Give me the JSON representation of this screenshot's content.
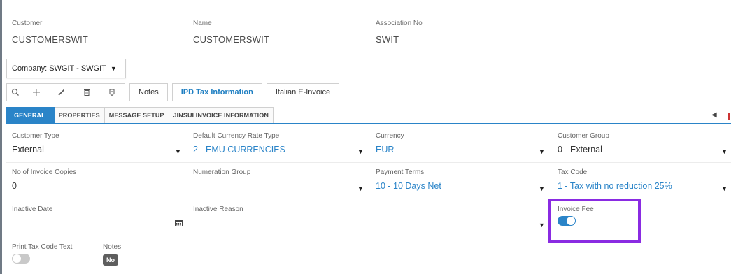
{
  "header": {
    "customer": {
      "label": "Customer",
      "value": "CUSTOMERSWIT"
    },
    "name": {
      "label": "Name",
      "value": "CUSTOMERSWIT"
    },
    "association": {
      "label": "Association No",
      "value": "SWIT"
    }
  },
  "company": {
    "label": "Company: SWGIT - SWGIT"
  },
  "toolbar": {
    "icons": [
      "search-icon",
      "add-icon",
      "edit-icon",
      "delete-icon",
      "duplicate-icon"
    ],
    "notes_label": "Notes",
    "ipd_label": "IPD Tax Information",
    "italian_label": "Italian E-Invoice"
  },
  "tabs": [
    {
      "label": "GENERAL",
      "active": true
    },
    {
      "label": "PROPERTIES",
      "active": false
    },
    {
      "label": "MESSAGE SETUP",
      "active": false
    },
    {
      "label": "JINSUI INVOICE INFORMATION",
      "active": false
    }
  ],
  "form": {
    "customer_type": {
      "label": "Customer Type",
      "value": "External"
    },
    "currency_rate_type": {
      "label": "Default Currency Rate Type",
      "value": "2 - EMU CURRENCIES"
    },
    "currency": {
      "label": "Currency",
      "value": "EUR"
    },
    "customer_group": {
      "label": "Customer Group",
      "value": "0 - External"
    },
    "invoice_copies": {
      "label": "No of Invoice Copies",
      "value": "0"
    },
    "numeration_group": {
      "label": "Numeration Group",
      "value": ""
    },
    "payment_terms": {
      "label": "Payment Terms",
      "value": "10 - 10 Days Net"
    },
    "tax_code": {
      "label": "Tax Code",
      "value": "1 - Tax with no reduction 25%"
    },
    "inactive_date": {
      "label": "Inactive Date",
      "value": ""
    },
    "inactive_reason": {
      "label": "Inactive Reason",
      "value": ""
    },
    "invoice_fee": {
      "label": "Invoice Fee",
      "on": true
    },
    "print_tax_code_text": {
      "label": "Print Tax Code Text",
      "on": false
    },
    "notes": {
      "label": "Notes",
      "value": "No"
    }
  },
  "colors": {
    "accent": "#2a84c8",
    "highlight": "#8a2be2"
  }
}
